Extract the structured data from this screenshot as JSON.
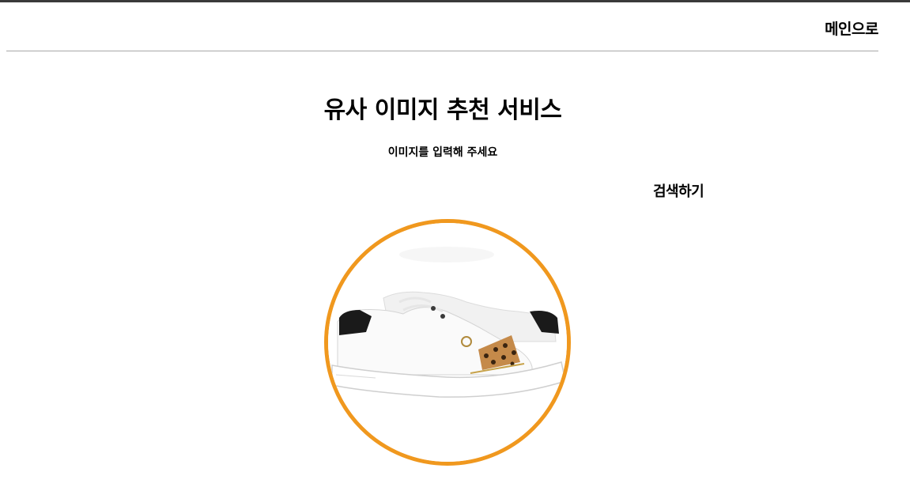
{
  "header": {
    "home_label": "메인으로"
  },
  "main": {
    "title": "유사 이미지 추천 서비스",
    "subtitle": "이미지를 입력해 주세요",
    "search_label": "검색하기"
  },
  "upload": {
    "image_subject": "white-sneakers-leopard-accent"
  },
  "colors": {
    "accent_ring": "#f0981e",
    "divider": "#a8a8a8",
    "top_strip": "#3a3a3a"
  }
}
